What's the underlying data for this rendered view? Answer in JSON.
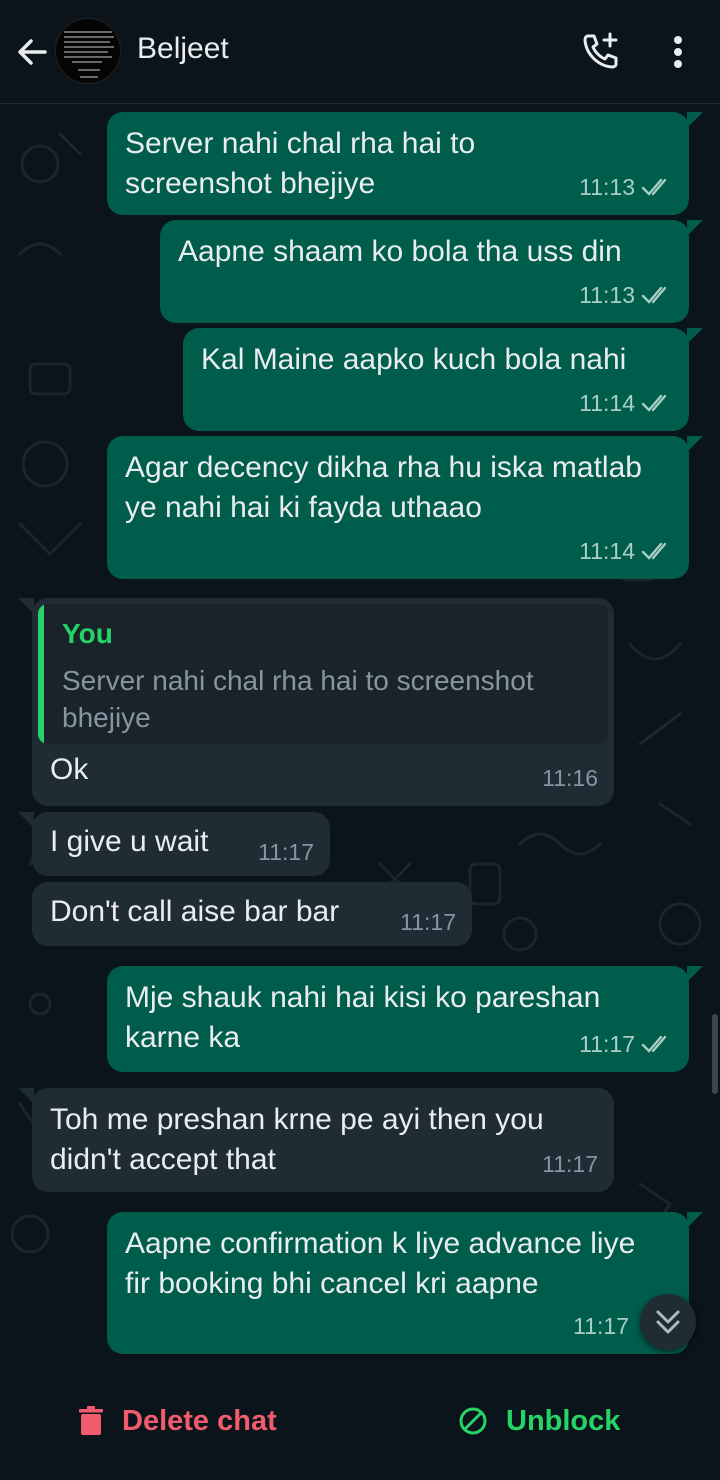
{
  "header": {
    "contact_name": "Beljeet"
  },
  "messages": [
    {
      "direction": "out",
      "text": "Server nahi chal rha hai to screenshot bhejiye",
      "time": "11:13"
    },
    {
      "direction": "out",
      "text": "Aapne shaam ko bola tha uss din",
      "time": "11:13"
    },
    {
      "direction": "out",
      "text": "Kal Maine aapko kuch bola nahi",
      "time": "11:14"
    },
    {
      "direction": "out",
      "text": "Agar decency dikha rha hu iska matlab ye nahi hai ki fayda uthaao",
      "time": "11:14"
    },
    {
      "direction": "in",
      "text": "Ok",
      "time": "11:16",
      "quote": {
        "author": "You",
        "text": "Server nahi chal rha hai to screenshot bhejiye"
      }
    },
    {
      "direction": "in",
      "text": "I give u wait",
      "time": "11:17"
    },
    {
      "direction": "in",
      "text": "Don't call aise bar bar",
      "time": "11:17"
    },
    {
      "direction": "out",
      "text": "Mje shauk nahi hai kisi ko pareshan karne ka",
      "time": "11:17"
    },
    {
      "direction": "in",
      "text": "Toh me preshan krne pe ayi then you didn't accept that",
      "time": "11:17"
    },
    {
      "direction": "out",
      "text": "Aapne confirmation k liye advance liye fir booking bhi cancel kri aapne",
      "time": "11:17"
    }
  ],
  "footer": {
    "delete_label": "Delete chat",
    "unblock_label": "Unblock"
  },
  "icons": {
    "back": "arrow-left-icon",
    "call": "add-call-icon",
    "menu": "more-vert-icon",
    "read": "double-check-icon",
    "scroll": "double-chevron-down-icon",
    "delete": "trash-icon",
    "unblock": "unblock-icon"
  },
  "colors": {
    "background": "#0b141a",
    "outgoing_bubble": "#005c4b",
    "incoming_bubble": "#202c33",
    "accent_green": "#25d366",
    "danger_red": "#f15c6d"
  }
}
